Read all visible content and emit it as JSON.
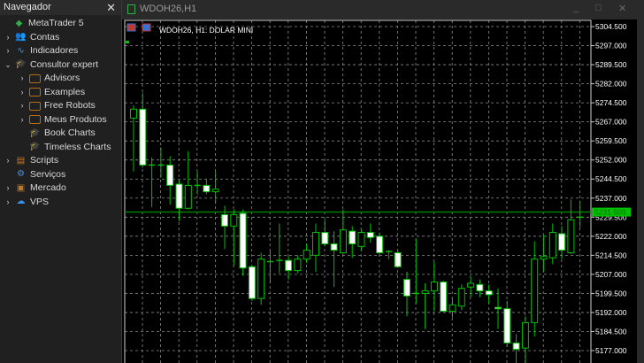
{
  "navigator": {
    "title": "Navegador",
    "items": [
      {
        "label": "MetaTrader 5",
        "icon": "metatrader-logo-icon",
        "level": 0,
        "arrow": ""
      },
      {
        "label": "Contas",
        "icon": "accounts-icon",
        "level": 1,
        "arrow": "›"
      },
      {
        "label": "Indicadores",
        "icon": "indicators-icon",
        "level": 1,
        "arrow": "›"
      },
      {
        "label": "Consultor expert",
        "icon": "expert-advisor-icon",
        "level": 1,
        "arrow": "⌄"
      },
      {
        "label": "Advisors",
        "icon": "folder-icon",
        "level": 2,
        "arrow": "›"
      },
      {
        "label": "Examples",
        "icon": "folder-icon",
        "level": 2,
        "arrow": "›"
      },
      {
        "label": "Free Robots",
        "icon": "folder-icon",
        "level": 2,
        "arrow": "›"
      },
      {
        "label": "Meus Produtos",
        "icon": "folder-icon",
        "level": 2,
        "arrow": "›"
      },
      {
        "label": "Book Charts",
        "icon": "expert-advisor-icon",
        "level": 2,
        "arrow": ""
      },
      {
        "label": "Timeless Charts",
        "icon": "expert-advisor-icon",
        "level": 2,
        "arrow": ""
      },
      {
        "label": "Scripts",
        "icon": "script-icon",
        "level": 1,
        "arrow": "›"
      },
      {
        "label": "Serviços",
        "icon": "services-icon",
        "level": 1,
        "arrow": ""
      },
      {
        "label": "Mercado",
        "icon": "market-bag-icon",
        "level": 1,
        "arrow": "›"
      },
      {
        "label": "VPS",
        "icon": "cloud-icon",
        "level": 1,
        "arrow": "›"
      }
    ]
  },
  "chart_window": {
    "title": "WDOH26,H1",
    "symbol_label": "WDOH26, H1:  DOLAR MINI",
    "minimize": "_",
    "maximize": "□",
    "close": "✕"
  },
  "colors": {
    "bull": "#00c000",
    "bear_fill": "#ffffff",
    "grid": "#8a8a8a",
    "bid_line": "#008000",
    "bid_label": "#00c000"
  },
  "chart_data": {
    "type": "candlestick",
    "symbol": "WDOH26",
    "timeframe": "H1",
    "ylim": [
      5177.0,
      5304.5
    ],
    "y_ticks": [
      "5304.500",
      "5297.000",
      "5289.500",
      "5282.000",
      "5274.500",
      "5267.000",
      "5259.500",
      "5252.000",
      "5244.500",
      "5237.000",
      "5229.500",
      "5222.000",
      "5214.500",
      "5207.000",
      "5199.500",
      "5192.000",
      "5184.500",
      "5177.000"
    ],
    "current_price": "5231.500",
    "ohlc": [
      [
        5268.5,
        5273.5,
        5247.5,
        5272
      ],
      [
        5272,
        5278.5,
        5249,
        5250
      ],
      [
        5250,
        5253,
        5233.5,
        5250
      ],
      [
        5250,
        5257,
        5245,
        5250
      ],
      [
        5250,
        5253.5,
        5234.5,
        5242
      ],
      [
        5242.5,
        5244,
        5228,
        5233
      ],
      [
        5233,
        5255.5,
        5232.5,
        5242
      ],
      [
        5242,
        5247.5,
        5238.5,
        5242
      ],
      [
        5242,
        5244.5,
        5238.5,
        5239.5
      ],
      [
        5239.5,
        5247.5,
        5235,
        5240.5
      ],
      [
        5230.5,
        5234,
        5217,
        5226
      ],
      [
        5226,
        5232.5,
        5210.5,
        5230.5
      ],
      [
        5231,
        5232.5,
        5206.5,
        5209.5
      ],
      [
        5210,
        5210.5,
        5196.5,
        5197.5
      ],
      [
        5197.5,
        5215.5,
        5195,
        5213
      ],
      [
        5212,
        5216.5,
        5203.5,
        5212
      ],
      [
        5212.5,
        5227,
        5207.5,
        5212.5
      ],
      [
        5212.5,
        5214,
        5205,
        5208.5
      ],
      [
        5208.5,
        5214.5,
        5207.5,
        5213
      ],
      [
        5213,
        5219,
        5211.5,
        5216.5
      ],
      [
        5214.5,
        5227,
        5208,
        5223.5
      ],
      [
        5223.5,
        5228.5,
        5218,
        5219
      ],
      [
        5219,
        5224,
        5202,
        5216.5
      ],
      [
        5215.5,
        5232.5,
        5215,
        5224.5
      ],
      [
        5224,
        5226,
        5213.5,
        5219
      ],
      [
        5218,
        5224.5,
        5216.5,
        5223.5
      ],
      [
        5223.5,
        5227,
        5219.5,
        5221.5
      ],
      [
        5222,
        5223.5,
        5215,
        5215.5
      ],
      [
        5216,
        5216.5,
        5213,
        5216
      ],
      [
        5215.5,
        5216.5,
        5209.5,
        5210
      ],
      [
        5205,
        5208,
        5190.5,
        5198.5
      ],
      [
        5199.5,
        5221,
        5195.5,
        5199.5
      ],
      [
        5199.5,
        5203.5,
        5185.5,
        5200.5
      ],
      [
        5200.5,
        5212,
        5192.5,
        5204
      ],
      [
        5204,
        5204.5,
        5192,
        5192.5
      ],
      [
        5192.5,
        5197.5,
        5190,
        5195
      ],
      [
        5194.5,
        5203,
        5193,
        5201.5
      ],
      [
        5202,
        5206,
        5198,
        5203.5
      ],
      [
        5203,
        5205,
        5198,
        5200.5
      ],
      [
        5200.5,
        5203,
        5195.5,
        5199
      ],
      [
        5194,
        5201.5,
        5185.5,
        5193.5
      ],
      [
        5193.5,
        5196.5,
        5178.5,
        5180
      ],
      [
        5180,
        5183.5,
        5172,
        5177.5
      ],
      [
        5178,
        5190.5,
        5172,
        5188
      ],
      [
        5188,
        5220,
        5182.5,
        5213
      ],
      [
        5213,
        5222.5,
        5208,
        5214
      ],
      [
        5213.5,
        5227,
        5211,
        5223.5
      ],
      [
        5223,
        5226,
        5213,
        5216.5
      ],
      [
        5215.5,
        5236.5,
        5215,
        5228.5
      ],
      [
        5229.5,
        5236,
        5225.5,
        5229.5
      ]
    ]
  }
}
